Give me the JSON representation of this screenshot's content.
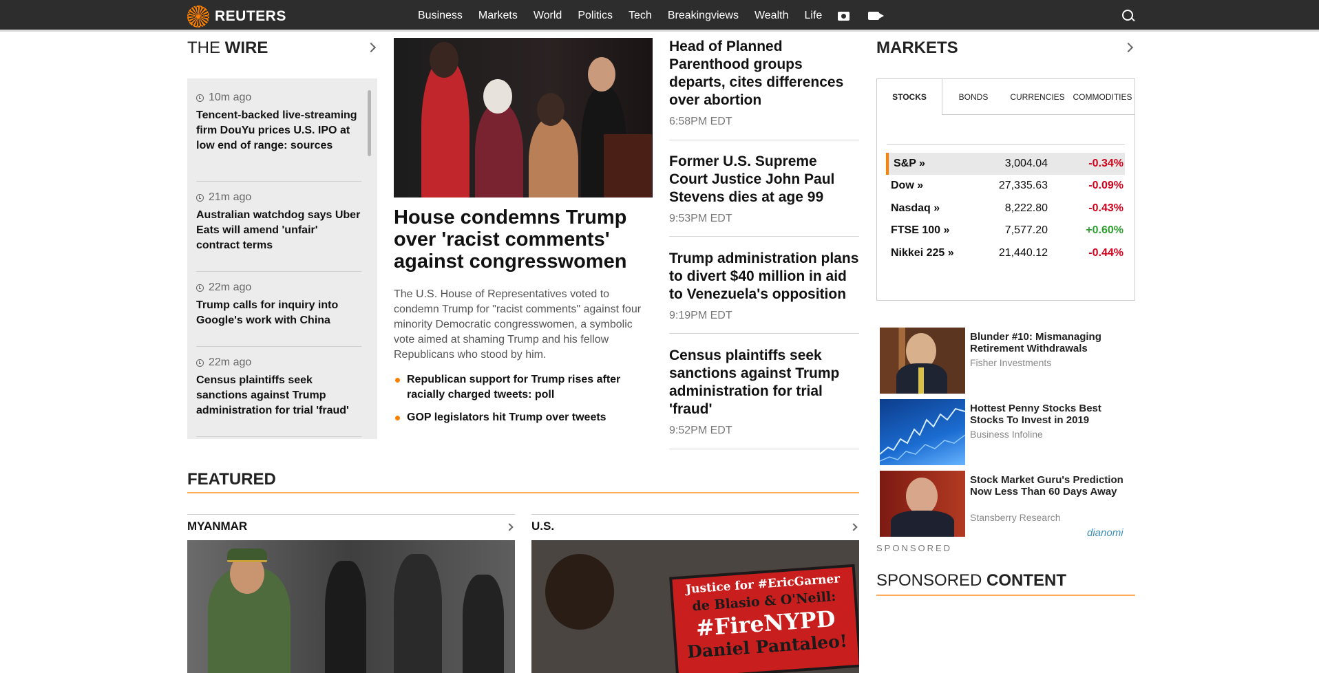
{
  "brand": {
    "name": "REUTERS"
  },
  "nav": {
    "items": [
      "Business",
      "Markets",
      "World",
      "Politics",
      "Tech",
      "Breakingviews",
      "Wealth",
      "Life"
    ],
    "icons": [
      "camera-icon",
      "video-icon",
      "search-icon"
    ]
  },
  "wire": {
    "title_light": "THE ",
    "title_bold": "WIRE",
    "items": [
      {
        "time": "10m ago",
        "headline": "Tencent-backed live-streaming firm DouYu prices U.S. IPO at low end of range: sources"
      },
      {
        "time": "21m ago",
        "headline": "Australian watchdog says Uber Eats will amend 'unfair' contract terms"
      },
      {
        "time": "22m ago",
        "headline": "Trump calls for inquiry into Google's work with China"
      },
      {
        "time": "22m ago",
        "headline": "Census plaintiffs seek sanctions against Trump administration for trial 'fraud'"
      }
    ]
  },
  "lead": {
    "headline": "House condemns Trump over 'racist comments' against congresswomen",
    "summary": "The U.S. House of Representatives voted to condemn Trump for \"racist comments\" against four minority Democratic congresswomen, a symbolic vote aimed at shaming Trump and his fellow Republicans who stood by him.",
    "related": [
      "Republican support for Trump rises after racially charged tweets: poll",
      "GOP legislators hit Trump over tweets"
    ]
  },
  "stories": [
    {
      "headline": "Head of Planned Parenthood groups departs, cites differences over abortion",
      "time": "6:58PM EDT"
    },
    {
      "headline": "Former U.S. Supreme Court Justice John Paul Stevens dies at age 99",
      "time": "9:53PM EDT"
    },
    {
      "headline": "Trump administration plans to divert $40 million in aid to Venezuela's opposition",
      "time": "9:19PM EDT"
    },
    {
      "headline": "Census plaintiffs seek sanctions against Trump administration for trial 'fraud'",
      "time": "9:52PM EDT"
    }
  ],
  "markets": {
    "title": "MARKETS",
    "tabs": [
      "STOCKS",
      "BONDS",
      "CURRENCIES",
      "COMMODITIES"
    ],
    "active_tab": "STOCKS",
    "rows": [
      {
        "name": "S&P »",
        "value": "3,004.04",
        "change": "-0.34%",
        "direction": "down"
      },
      {
        "name": "Dow »",
        "value": "27,335.63",
        "change": "-0.09%",
        "direction": "down"
      },
      {
        "name": "Nasdaq »",
        "value": "8,222.80",
        "change": "-0.43%",
        "direction": "down"
      },
      {
        "name": "FTSE 100 »",
        "value": "7,577.20",
        "change": "+0.60%",
        "direction": "up"
      },
      {
        "name": "Nikkei 225 »",
        "value": "21,440.12",
        "change": "-0.44%",
        "direction": "down"
      }
    ],
    "colors": {
      "down": "#d0021b",
      "up": "#2e9e2e"
    }
  },
  "ads": [
    {
      "title": "Blunder #10: Mismanaging Retirement Withdrawals",
      "source": "Fisher Investments"
    },
    {
      "title": "Hottest Penny Stocks   Best Stocks To Invest in 2019",
      "source": "Business Infoline"
    },
    {
      "title": "Stock Market Guru's Prediction Now Less Than 60 Days Away",
      "source": "Stansberry Research"
    }
  ],
  "ad_network": "dianomi",
  "sponsored_label": "SPONSORED",
  "sponsored_content": {
    "title_light": "SPONSORED ",
    "title_bold": "CONTENT"
  },
  "featured": {
    "title": "FEATURED",
    "sections": [
      "MYANMAR",
      "U.S."
    ],
    "sign_text": [
      "Justice for #EricGarner",
      "de Blasio & O'Neill:",
      "#FireNYPD",
      "Daniel Pantaleo!"
    ]
  },
  "colors": {
    "accent": "#ff8000",
    "nav_bg": "#2d2d2d"
  }
}
